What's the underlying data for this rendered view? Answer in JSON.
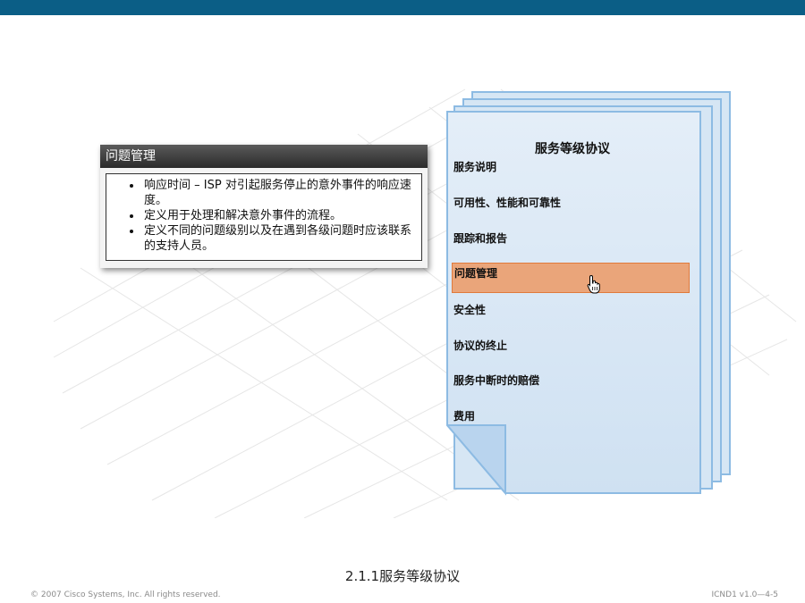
{
  "document": {
    "title": "服务等级协议",
    "items": [
      {
        "label": "服务说明"
      },
      {
        "label": "可用性、性能和可靠性"
      },
      {
        "label": "跟踪和报告"
      },
      {
        "label": "问题管理",
        "highlighted": true
      },
      {
        "label": "安全性"
      },
      {
        "label": "协议的终止"
      },
      {
        "label": "服务中断时的赔偿"
      },
      {
        "label": "费用"
      }
    ]
  },
  "callout": {
    "title": "问题管理",
    "bullets": [
      "响应时间 – ISP 对引起服务停止的意外事件的响应速度。",
      "定义用于处理和解决意外事件的流程。",
      "定义不同的问题级别以及在遇到各级问题时应该联系的支持人员。"
    ]
  },
  "caption": "2.1.1服务等级协议",
  "footer": {
    "copyright": "© 2007 Cisco Systems, Inc. All rights reserved.",
    "page_id": "ICND1 v1.0—4-5"
  },
  "colors": {
    "top_bar": "#0b5e86",
    "highlight": "#eaa57a",
    "page_fill": "#d6e6f4",
    "page_border": "#8dbbe3"
  },
  "icons": {
    "cursor": "hand-pointer-icon"
  }
}
